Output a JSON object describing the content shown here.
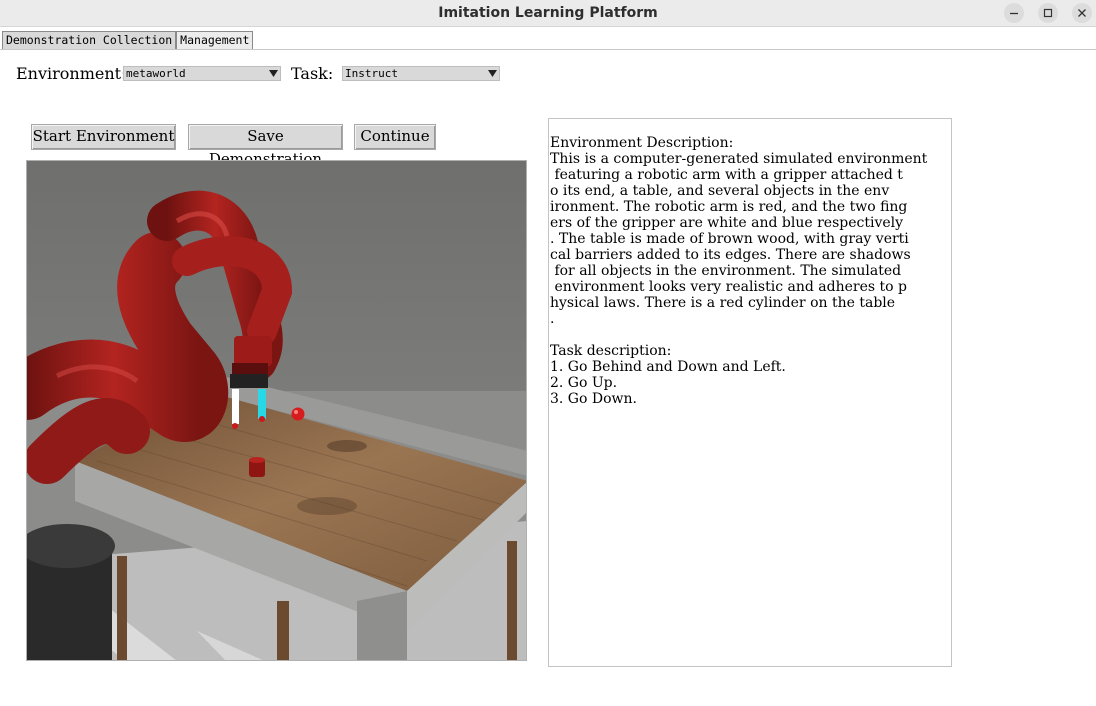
{
  "window": {
    "title": "Imitation Learning Platform",
    "controls": [
      "minimize-icon",
      "maximize-icon",
      "close-icon"
    ]
  },
  "tabs": [
    {
      "label": "Demonstration Collection",
      "active": false
    },
    {
      "label": "Management",
      "active": true
    }
  ],
  "selectors": {
    "environment_label": "Environment:",
    "environment_value": "metaworld",
    "task_label": "Task:",
    "task_value": "Instruct"
  },
  "buttons": {
    "start": "Start Environment",
    "save": "Save Demonstration",
    "continue": "Continue"
  },
  "description": {
    "lines": [
      "Environment Description:",
      "This is a computer-generated simulated environment",
      " featuring a robotic arm with a gripper attached t",
      "o its end, a table, and several objects in the env",
      "ironment. The robotic arm is red, and the two fing",
      "ers of the gripper are white and blue respectively",
      ". The table is made of brown wood, with gray verti",
      "cal barriers added to its edges. There are shadows",
      " for all objects in the environment. The simulated",
      " environment looks very realistic and adheres to p",
      "hysical laws. There is a red cylinder on the table",
      ".",
      "",
      "Task description:",
      "1. Go Behind and Down and Left.",
      "2. Go Up.",
      "3. Go Down."
    ]
  },
  "colors": {
    "robot_arm": "#9e1c1a",
    "table_wood": "#8a6a4a",
    "gripper_finger_left": "#ffffff",
    "gripper_finger_right": "#27d8e6",
    "background_wall": "#7a7a78"
  }
}
